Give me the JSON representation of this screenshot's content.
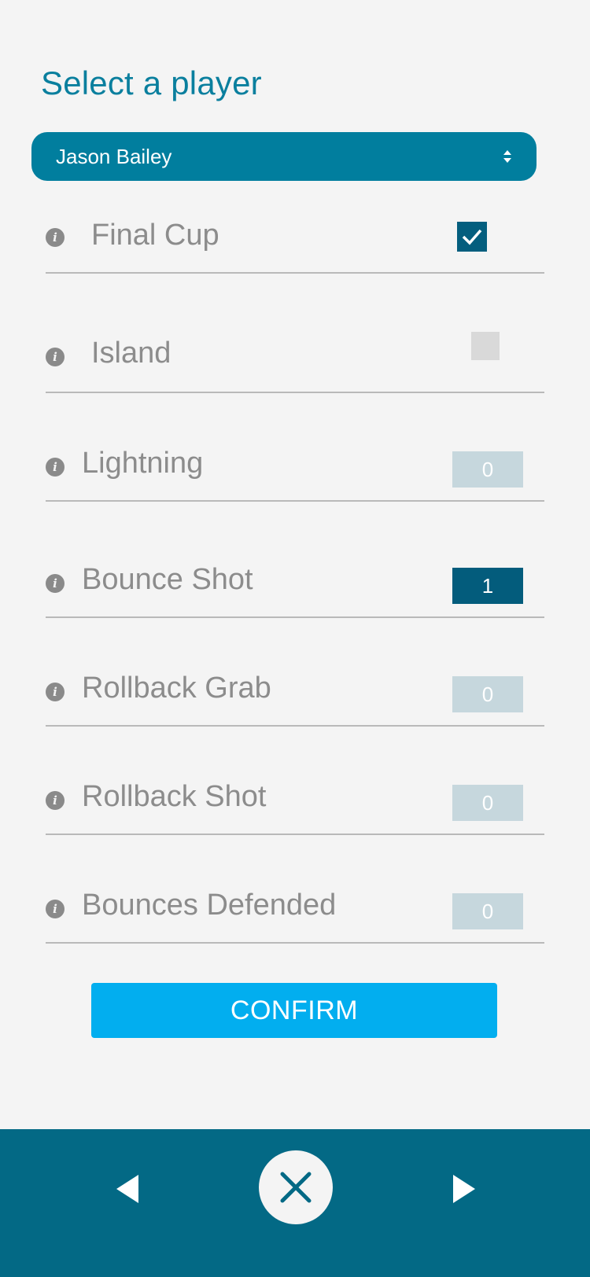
{
  "page": {
    "title": "Select a player"
  },
  "player_select": {
    "selected": "Jason Bailey"
  },
  "stats": [
    {
      "label": "Final Cup",
      "type": "checkbox",
      "checked": true,
      "icon": "info-icon"
    },
    {
      "label": "Island",
      "type": "checkbox",
      "checked": false,
      "icon": "info-icon"
    },
    {
      "label": "Lightning",
      "type": "counter",
      "value": "0",
      "icon": "info-icon"
    },
    {
      "label": "Bounce Shot",
      "type": "counter",
      "value": "1",
      "icon": "info-icon"
    },
    {
      "label": "Rollback Grab",
      "type": "counter",
      "value": "0",
      "icon": "info-icon"
    },
    {
      "label": "Rollback Shot",
      "type": "counter",
      "value": "0",
      "icon": "info-icon"
    },
    {
      "label": "Bounces Defended",
      "type": "counter",
      "value": "0",
      "icon": "info-icon"
    }
  ],
  "confirm_label": "CONFIRM",
  "bottom_nav": {
    "prev_icon": "triangle-left-icon",
    "close_icon": "close-icon",
    "next_icon": "triangle-right-icon"
  },
  "colors": {
    "accent": "#017e9e",
    "title": "#0a7f9e",
    "confirm": "#02aeef",
    "bottom_bar": "#036985",
    "counter_active": "#035c7c",
    "counter_inactive": "#c6d7dd"
  }
}
